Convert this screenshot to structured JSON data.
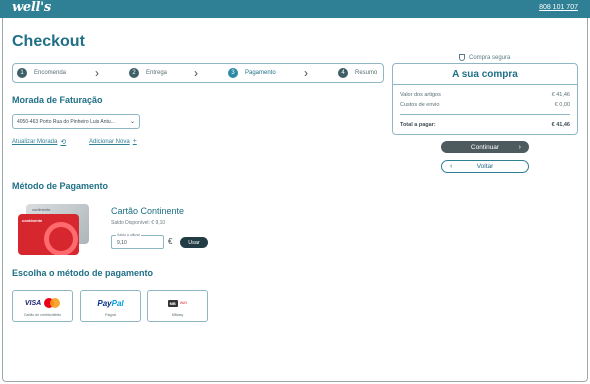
{
  "header": {
    "logo": "well's",
    "phone": "808 101 707"
  },
  "page_title": "Checkout",
  "steps": [
    {
      "num": "1",
      "label": "Encomenda"
    },
    {
      "num": "2",
      "label": "Entrega"
    },
    {
      "num": "3",
      "label": "Pagamento"
    },
    {
      "num": "4",
      "label": "Resumo"
    }
  ],
  "secure_label": "Compra segura",
  "summary": {
    "title": "A sua compra",
    "rows": [
      {
        "label": "Valor dos artigos",
        "value": "€ 41,46"
      },
      {
        "label": "Custos de envio",
        "value": "€ 0,00"
      }
    ],
    "total": {
      "label": "Total a pagar:",
      "value": "€ 41,46"
    }
  },
  "buttons": {
    "continue": "Continuar",
    "back": "Voltar"
  },
  "billing": {
    "heading": "Morada de Faturação",
    "address": "4050-463 Porto Rua do Pinheiro Luis Antu...",
    "update_link": "Atualizar Morada",
    "add_link": "Adicionar Nova"
  },
  "payment_method": {
    "heading": "Método de Pagamento",
    "card_gray_brand": "continente",
    "card_red_brand": "continente",
    "card_title": "Cartão Continente",
    "balance_text": "Saldo Disponível: € 9,10",
    "input_label": "Saldo a utilizar",
    "input_value": "9,10",
    "currency": "€",
    "use_button": "Usar"
  },
  "choose": {
    "heading": "Escolha o método de pagamento",
    "options": [
      {
        "visa": "VISA",
        "caption": "Cartão de crédito/débito"
      },
      {
        "paypal_a": "Pay",
        "paypal_b": "Pal",
        "caption": "Paypal"
      },
      {
        "mb": "MB",
        "way": "WAY",
        "caption": "MBway"
      }
    ]
  },
  "colors": {
    "brand": "#2f7f95",
    "dark_button": "#4d5a5e",
    "card_red": "#d6262e"
  }
}
